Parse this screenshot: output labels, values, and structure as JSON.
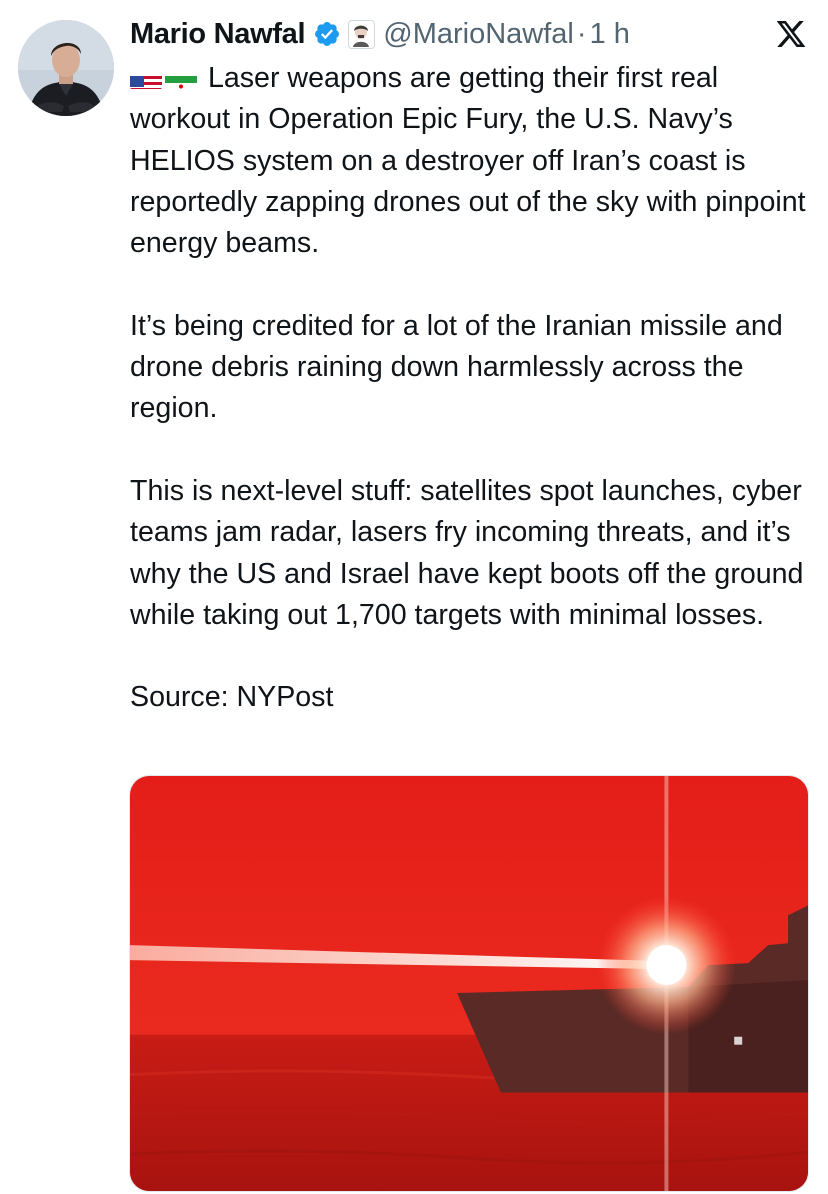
{
  "author": {
    "name": "Mario Nawfal",
    "handle": "@MarioNawfal",
    "separator": "·",
    "time": "1 h"
  },
  "icons": {
    "verified": "verified-badge-icon",
    "affiliate": "affiliate-badge-icon",
    "x_logo": "x-logo-icon",
    "flag_us": "us-flag-icon",
    "flag_iran": "iran-flag-icon"
  },
  "colors": {
    "verified_blue": "#1d9bf0",
    "secondary_text": "#536471",
    "media_red": "#e8211b"
  },
  "tweet": {
    "paragraphs": [
      "Laser weapons are getting their first real workout in Operation Epic Fury, the U.S. Navy’s HELIOS system on a destroyer off Iran’s coast is reportedly zapping drones out of the sky with pinpoint energy beams.",
      "It’s being credited for a lot of the Iranian missile and drone debris raining down harmlessly across the region.",
      "This is next-level stuff: satellites spot launches, cyber teams jam radar, lasers fry incoming threats, and it’s why the US and Israel have kept boots off the ground while taking out 1,700 targets with minimal losses.",
      "Source: NYPost"
    ]
  }
}
